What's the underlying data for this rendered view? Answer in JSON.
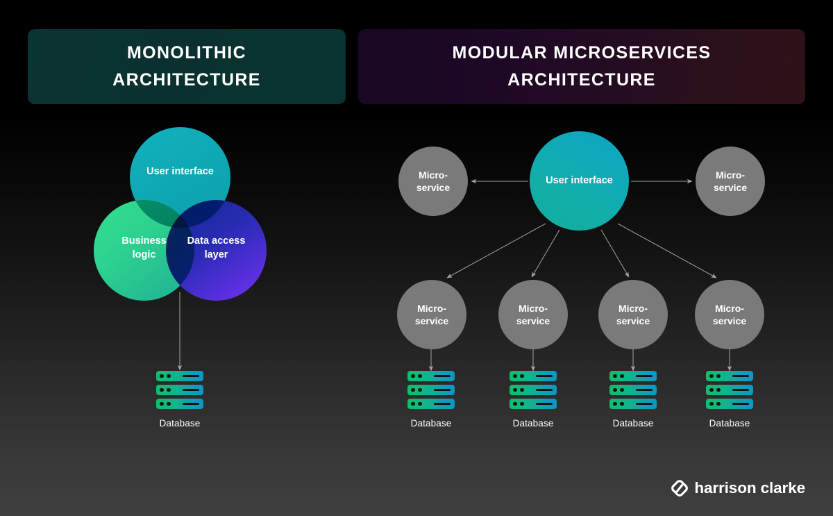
{
  "banners": {
    "monolithic": {
      "line1": "MONOLITHIC",
      "line2": "ARCHITECTURE"
    },
    "microservices": {
      "line1": "MODULAR MICROSERVICES",
      "line2": "ARCHITECTURE"
    }
  },
  "monolith": {
    "venn": {
      "user_interface": "User interface",
      "business_logic_line1": "Business",
      "business_logic_line2": "logic",
      "data_access_line1": "Data access",
      "data_access_line2": "layer"
    },
    "database_label": "Database"
  },
  "microservices": {
    "center_label": "User interface",
    "micro_line1": "Micro-",
    "micro_line2": "service",
    "nodes": [
      {
        "id": "micro-left",
        "label_line1": "Micro-",
        "label_line2": "service"
      },
      {
        "id": "micro-right",
        "label_line1": "Micro-",
        "label_line2": "service"
      },
      {
        "id": "micro-b1",
        "label_line1": "Micro-",
        "label_line2": "service"
      },
      {
        "id": "micro-b2",
        "label_line1": "Micro-",
        "label_line2": "service"
      },
      {
        "id": "micro-b3",
        "label_line1": "Micro-",
        "label_line2": "service"
      },
      {
        "id": "micro-b4",
        "label_line1": "Micro-",
        "label_line2": "service"
      }
    ],
    "databases": [
      {
        "label": "Database"
      },
      {
        "label": "Database"
      },
      {
        "label": "Database"
      },
      {
        "label": "Database"
      }
    ]
  },
  "logo": {
    "text": "harrison clarke"
  },
  "colors": {
    "background_top": "#000000",
    "background_bottom": "#3f3f3f",
    "banner_monolithic": "#0a3230",
    "banner_microservices_start": "#190724",
    "banner_microservices_end": "#2f1118",
    "venn_teal": "#0ea8b4",
    "venn_green": "#2ed18f",
    "venn_blue": "#3a2cc4",
    "micro_gray": "#7a7a7a",
    "db_gradient_start": "#0fbf6b",
    "db_gradient_end": "#0e96c4",
    "arrow": "#9a9a9a",
    "text": "#ffffff"
  }
}
